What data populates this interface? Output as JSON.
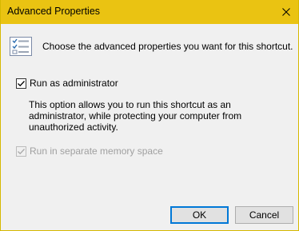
{
  "window": {
    "title": "Advanced Properties"
  },
  "header": {
    "icon": "checklist-icon",
    "text": "Choose the advanced properties you want for this shortcut."
  },
  "options": [
    {
      "label": "Run as administrator",
      "checked": true,
      "enabled": true
    },
    {
      "label": "Run in separate memory space",
      "checked": true,
      "enabled": false
    }
  ],
  "description": "This option allows you to run this shortcut as an administrator, while protecting your computer from unauthorized activity.",
  "buttons": {
    "ok_label": "OK",
    "cancel_label": "Cancel"
  },
  "colors": {
    "titlebar": "#eac312",
    "accent": "#0078d7"
  }
}
